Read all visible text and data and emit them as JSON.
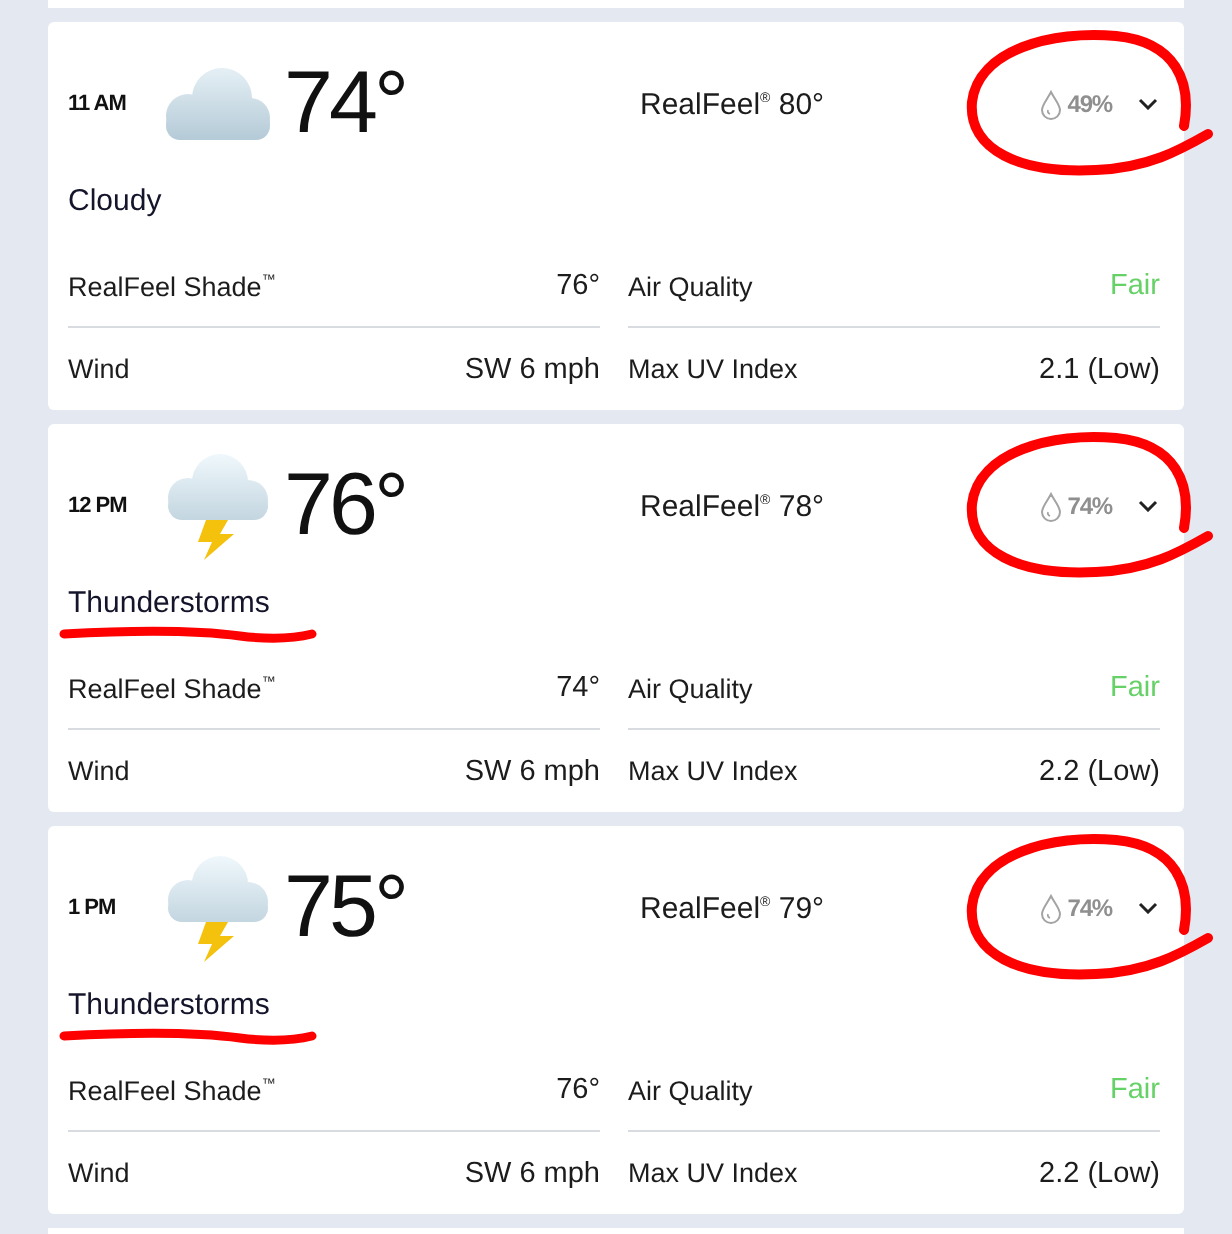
{
  "hours": [
    {
      "time": "11 AM",
      "kind": "cloudy",
      "temperature": "74°",
      "realfeel": "RealFeel$^{®}$ 80°",
      "precipitation": "49%",
      "precip_circled": true,
      "condition": "Cloudy",
      "condition_underlined": false,
      "details": [
        {
          "label": "RealFeel Shade$^{™}$",
          "value": "76°"
        },
        {
          "label": "Air Quality",
          "value": "Fair",
          "color": "#66d166"
        },
        {
          "label": "Wind",
          "value": "SW 6 mph"
        },
        {
          "label": "Max UV Index",
          "value": "2.1 (Low)"
        }
      ]
    },
    {
      "time": "12 PM",
      "kind": "thunderstorm",
      "temperature": "76°",
      "realfeel": "RealFeel$^{®}$ 78°",
      "precipitation": "74%",
      "precip_circled": true,
      "condition": "Thunderstorms",
      "condition_underlined": true,
      "details": [
        {
          "label": "RealFeel Shade$^{™}$",
          "value": "74°"
        },
        {
          "label": "Air Quality",
          "value": "Fair",
          "color": "#66d166"
        },
        {
          "label": "Wind",
          "value": "SW 6 mph"
        },
        {
          "label": "Max UV Index",
          "value": "2.2 (Low)"
        }
      ]
    },
    {
      "time": "1 PM",
      "kind": "thunderstorm",
      "temperature": "75°",
      "realfeel": "RealFeel$^{®}$ 79°",
      "precipitation": "74%",
      "precip_circled": true,
      "condition": "Thunderstorms",
      "condition_underlined": true,
      "details": [
        {
          "label": "RealFeel Shade$^{™}$",
          "value": "76°"
        },
        {
          "label": "Air Quality",
          "value": "Fair",
          "color": "#66d166"
        },
        {
          "label": "Wind",
          "value": "SW 6 mph"
        },
        {
          "label": "Max UV Index",
          "value": "2.2 (Low)"
        }
      ]
    }
  ]
}
